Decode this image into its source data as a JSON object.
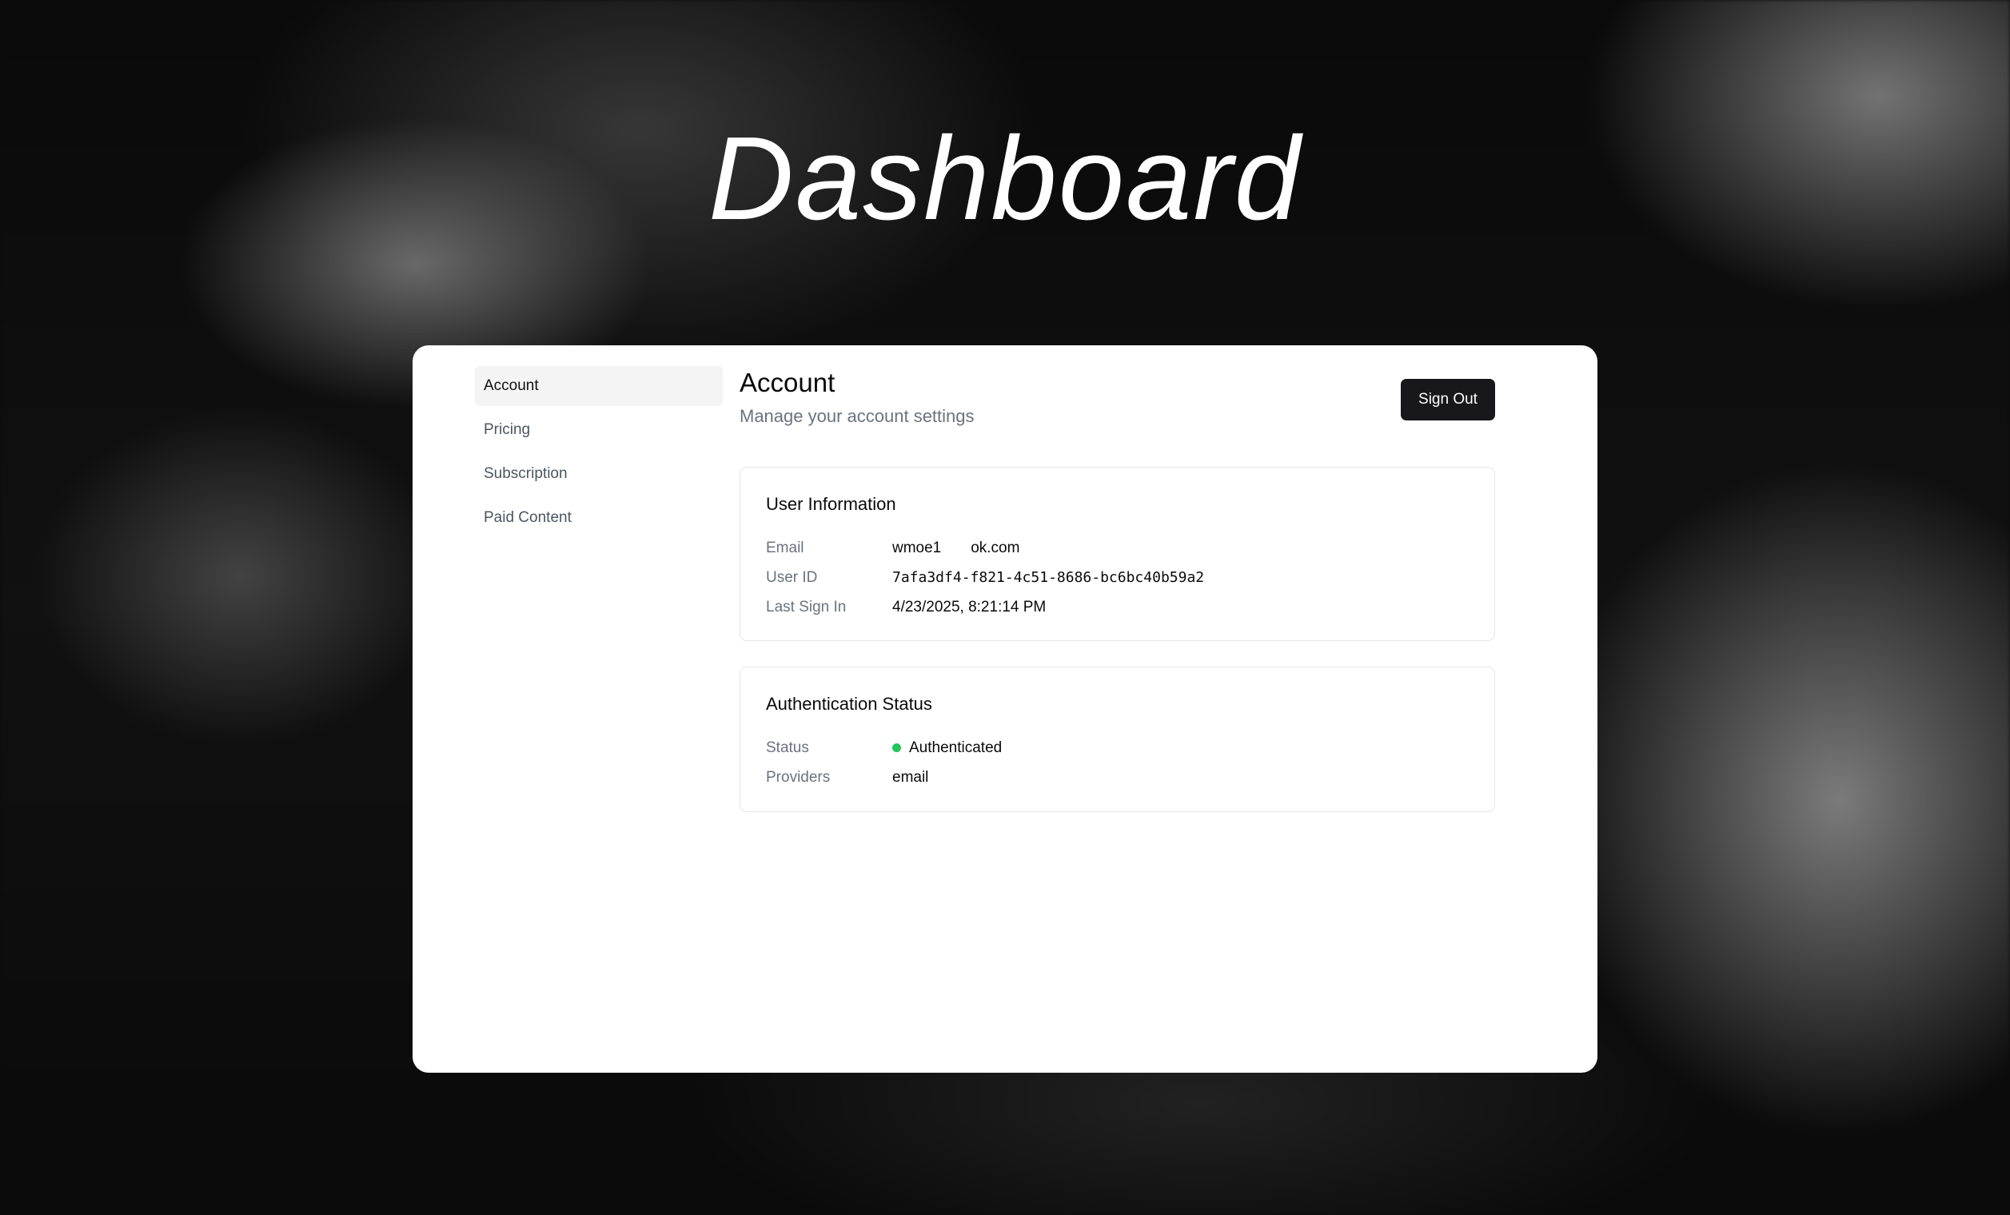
{
  "page": {
    "title": "Dashboard"
  },
  "sidebar": {
    "items": [
      {
        "label": "Account",
        "active": true
      },
      {
        "label": "Pricing",
        "active": false
      },
      {
        "label": "Subscription",
        "active": false
      },
      {
        "label": "Paid Content",
        "active": false
      }
    ]
  },
  "main": {
    "heading": "Account",
    "subheading": "Manage your account settings",
    "sign_out_label": "Sign Out"
  },
  "user_info": {
    "title": "User Information",
    "rows": [
      {
        "label": "Email",
        "value": "wmoe1       ok.com"
      },
      {
        "label": "User ID",
        "value": "7afa3df4-f821-4c51-8686-bc6bc40b59a2"
      },
      {
        "label": "Last Sign In",
        "value": "4/23/2025, 8:21:14 PM"
      }
    ]
  },
  "auth_status": {
    "title": "Authentication Status",
    "rows": [
      {
        "label": "Status",
        "value": "Authenticated"
      },
      {
        "label": "Providers",
        "value": "email"
      }
    ],
    "status_color": "#22c55e"
  },
  "colors": {
    "primary_button": "#18181b",
    "active_nav_bg": "#f4f4f5",
    "muted_text": "#6b7280"
  }
}
